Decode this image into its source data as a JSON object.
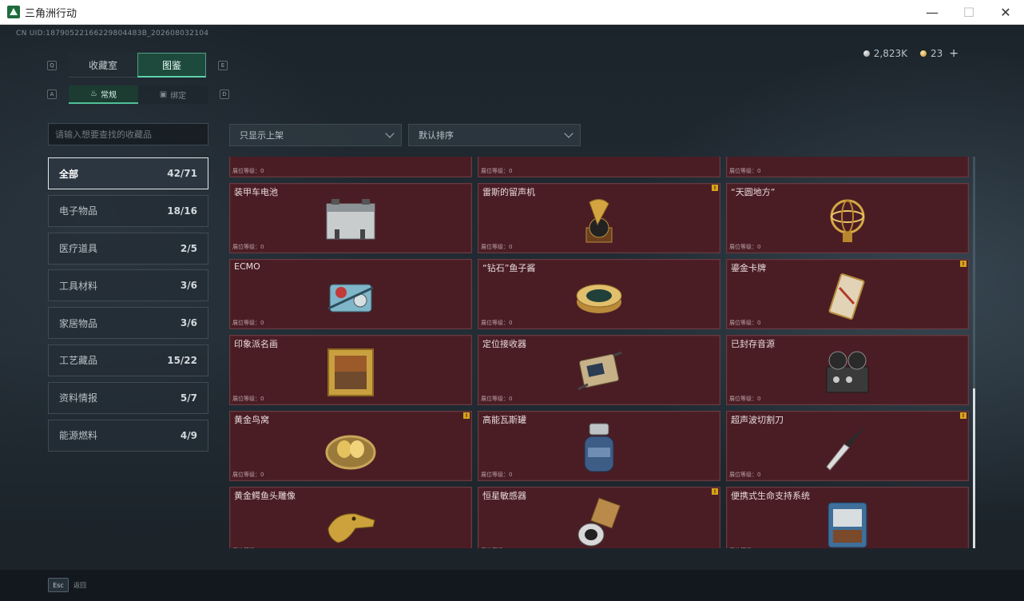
{
  "window": {
    "title": "三角洲行动",
    "min": "—",
    "max": "☐",
    "close": "✕"
  },
  "uid": "CN UID:18790522166229804483B_202608032104",
  "currency": {
    "silver": "2,823K",
    "gold": "23",
    "plus": "+"
  },
  "keyhints": {
    "left_main": "Q",
    "right_main": "E",
    "left_sub": "A",
    "right_sub": "D"
  },
  "main_tabs": [
    {
      "label": "收藏室"
    },
    {
      "label": "图鉴"
    }
  ],
  "sub_tabs": [
    {
      "label": "常规"
    },
    {
      "label": "绑定"
    }
  ],
  "search": {
    "placeholder": "请输入想要查找的收藏品"
  },
  "categories": [
    {
      "label": "全部",
      "count": "42/71"
    },
    {
      "label": "电子物品",
      "count": "18/16"
    },
    {
      "label": "医疗道具",
      "count": "2/5"
    },
    {
      "label": "工具材料",
      "count": "3/6"
    },
    {
      "label": "家居物品",
      "count": "3/6"
    },
    {
      "label": "工艺藏品",
      "count": "15/22"
    },
    {
      "label": "资料情报",
      "count": "5/7"
    },
    {
      "label": "能源燃料",
      "count": "4/9"
    }
  ],
  "filters": {
    "shelf": "只显示上架",
    "sort": "默认排序"
  },
  "level_label": "展位等级：0",
  "flag_mark": "!",
  "items": [
    {
      "name": "",
      "icon": "partial-item-icon"
    },
    {
      "name": "",
      "icon": "partial-item-icon"
    },
    {
      "name": "",
      "icon": "partial-item-icon"
    },
    {
      "name": "装甲车电池",
      "icon": "battery-icon"
    },
    {
      "name": "雷斯的留声机",
      "icon": "gramophone-icon"
    },
    {
      "name": "“天圆地方”",
      "icon": "armillary-sphere-icon"
    },
    {
      "name": "ECMO",
      "icon": "ecmo-machine-icon"
    },
    {
      "name": "“钻石”鱼子酱",
      "icon": "caviar-tin-icon"
    },
    {
      "name": "鎏金卡牌",
      "icon": "gold-card-icon"
    },
    {
      "name": "印象派名画",
      "icon": "framed-painting-icon"
    },
    {
      "name": "定位接收器",
      "icon": "receiver-icon"
    },
    {
      "name": "已封存音源",
      "icon": "reel-recorder-icon"
    },
    {
      "name": "黄金鸟窝",
      "icon": "golden-nest-icon"
    },
    {
      "name": "高能瓦斯罐",
      "icon": "gas-canister-icon"
    },
    {
      "name": "超声波切割刀",
      "icon": "ultrasonic-cutter-icon"
    },
    {
      "name": "黄金鳄鱼头雕像",
      "icon": "gold-crocodile-icon"
    },
    {
      "name": "恒星敏感器",
      "icon": "star-sensor-icon"
    },
    {
      "name": "便携式生命支持系统",
      "icon": "life-support-icon"
    }
  ],
  "flagged": [
    4,
    8,
    12,
    14,
    16
  ],
  "footer": {
    "key": "Esc",
    "label": "返回"
  },
  "colors": {
    "accent": "#4fbf95",
    "card_bg": "#4a1d24",
    "flag": "#d9a21d"
  }
}
